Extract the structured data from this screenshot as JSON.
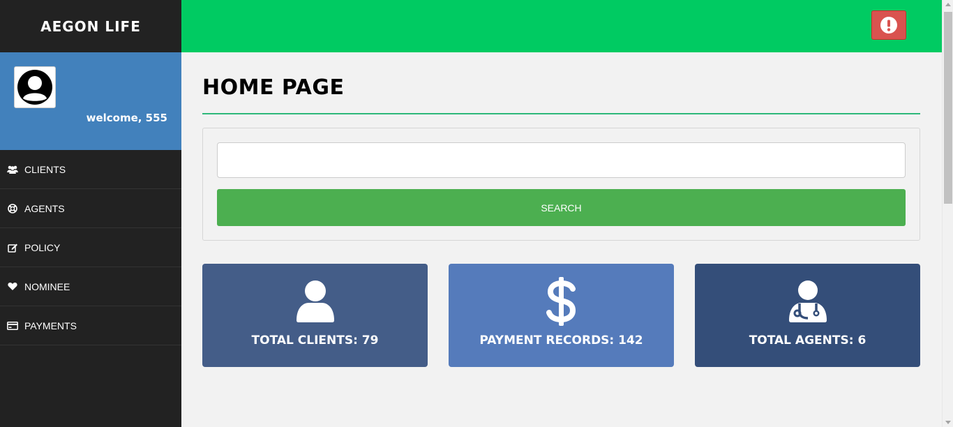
{
  "brand": {
    "title": "AEGON LIFE"
  },
  "profile": {
    "welcome": "welcome, 555"
  },
  "sidebar": {
    "items": [
      {
        "label": "CLIENTS",
        "icon": "users-icon"
      },
      {
        "label": "AGENTS",
        "icon": "life-ring-icon"
      },
      {
        "label": "POLICY",
        "icon": "edit-icon"
      },
      {
        "label": "NOMINEE",
        "icon": "heart-icon"
      },
      {
        "label": "PAYMENTS",
        "icon": "credit-card-icon"
      }
    ]
  },
  "topbar": {
    "color": "#00cb62",
    "alert_icon": "exclamation-circle-icon",
    "alert_color": "#d9534f"
  },
  "main": {
    "title": "HOME PAGE",
    "search": {
      "value": "",
      "placeholder": "",
      "button_label": "SEARCH"
    },
    "cards": [
      {
        "label": "TOTAL CLIENTS: 79",
        "icon": "user-icon",
        "color": "#445d88"
      },
      {
        "label": "PAYMENT RECORDS: 142",
        "icon": "dollar-icon",
        "color": "#557bbb"
      },
      {
        "label": "TOTAL AGENTS: 6",
        "icon": "user-doctor-icon",
        "color": "#344e79"
      }
    ]
  }
}
